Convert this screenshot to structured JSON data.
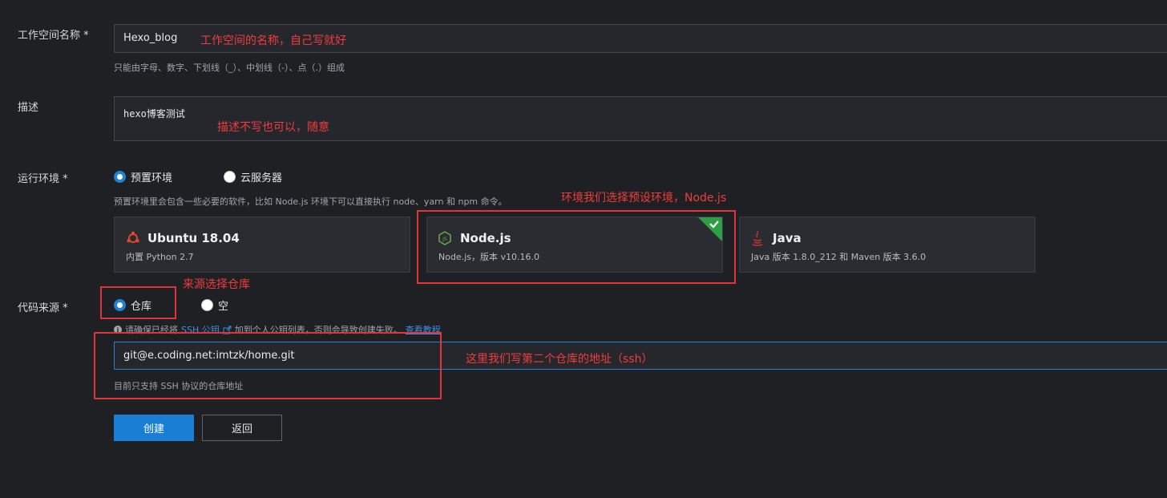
{
  "workspace": {
    "label": "工作空间名称 *",
    "value": "Hexo_blog",
    "hint": "只能由字母、数字、下划线（_）、中划线（-）、点（.）组成",
    "annotation": "工作空间的名称，自己写就好"
  },
  "description": {
    "label": "描述",
    "value": "hexo博客测试",
    "annotation": "描述不写也可以，随意"
  },
  "runtime": {
    "label": "运行环境 *",
    "options": [
      {
        "label": "预置环境",
        "selected": true
      },
      {
        "label": "云服务器",
        "selected": false
      }
    ],
    "hint": "预置环境里会包含一些必要的软件，比如 Node.js 环境下可以直接执行 node、yarn 和 npm 命令。",
    "annotation": "环境我们选择预设环境，Node.js",
    "cards": [
      {
        "title": "Ubuntu 18.04",
        "desc": "内置 Python 2.7",
        "icon": "ubuntu-icon",
        "icon_color": "#e2472b"
      },
      {
        "title": "Node.js",
        "desc": "Node.js，版本 v10.16.0",
        "icon": "nodejs-icon",
        "icon_color": "#6aa84f",
        "selected": true
      },
      {
        "title": "Java",
        "desc": "Java 版本 1.8.0_212 和 Maven 版本 3.6.0",
        "icon": "java-icon",
        "icon_color": "#c0392b"
      }
    ]
  },
  "source": {
    "label": "代码来源 *",
    "options": [
      {
        "label": "仓库",
        "selected": true
      },
      {
        "label": "空",
        "selected": false
      }
    ],
    "annotation": "来源选择仓库",
    "notice_prefix": "请确保已经将",
    "notice_link1": "SSH 公钥",
    "notice_middle": "加到个人公钥列表，否则会导致创建失败。",
    "notice_link2": "查看教程",
    "repo_value": "git@e.coding.net:imtzk/home.git",
    "repo_hint": "目前只支持 SSH 协议的仓库地址",
    "repo_annotation": "这里我们写第二个仓库的地址（ssh）"
  },
  "actions": {
    "create": "创建",
    "back": "返回"
  },
  "colors": {
    "accent": "#1a7fd4",
    "annotation_red": "#e0333b",
    "selected_green": "#2ea043"
  }
}
